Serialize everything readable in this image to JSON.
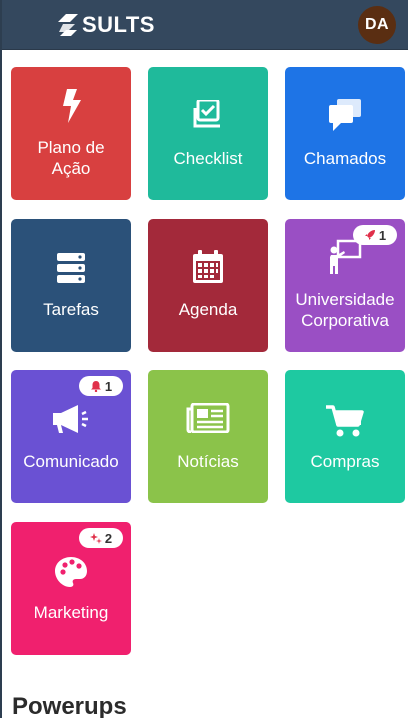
{
  "header": {
    "logo_text": "SULTS",
    "avatar_initials": "DA",
    "avatar_color": "#5a2e12"
  },
  "tiles": [
    {
      "label": "Plano de\nAção",
      "icon": "bolt-icon",
      "color": "#d84040"
    },
    {
      "label": "Checklist",
      "icon": "checklist-icon",
      "color": "#1fba9b"
    },
    {
      "label": "Chamados",
      "icon": "chat-bubbles-icon",
      "color": "#1e74e6"
    },
    {
      "label": "Tarefas",
      "icon": "server-stack-icon",
      "color": "#2b5179"
    },
    {
      "label": "Agenda",
      "icon": "calendar-icon",
      "color": "#a3293a"
    },
    {
      "label": "Universidade\nCorporativa",
      "icon": "teacher-board-icon",
      "color": "#9a4fc4",
      "badge": "1",
      "badge_icon": "rocket-icon"
    },
    {
      "label": "Comunicado",
      "icon": "megaphone-icon",
      "color": "#6a51d3",
      "badge": "1",
      "badge_icon": "bell-icon"
    },
    {
      "label": "Notícias",
      "icon": "newspaper-icon",
      "color": "#8bc34a"
    },
    {
      "label": "Compras",
      "icon": "cart-icon",
      "color": "#1ec9a1"
    },
    {
      "label": "Marketing",
      "icon": "palette-icon",
      "color": "#f0206e",
      "badge": "2",
      "badge_icon": "sparkles-icon"
    }
  ],
  "sections": {
    "powerups_title": "Powerups"
  }
}
